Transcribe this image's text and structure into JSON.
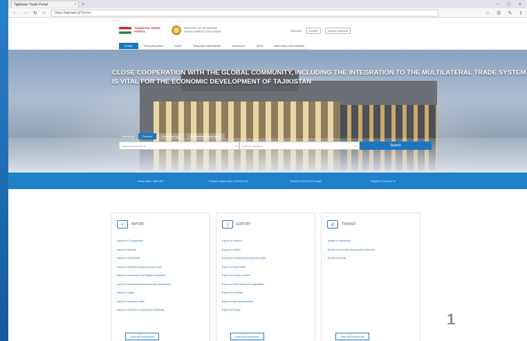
{
  "browser": {
    "tab_title": "Tajikistan Trade Portal",
    "tab_close": "×",
    "tab_new": "+",
    "url": "https://tajtrade.tj/?ru=en",
    "win_controls": [
      "−",
      "□",
      "×"
    ],
    "nav_icons": [
      "←",
      "→",
      "↻",
      "⌂"
    ],
    "right_icons": [
      "☆",
      "☰",
      "✎",
      "⇪"
    ]
  },
  "header": {
    "logo_text": "TAJIKISTAN TRADE PORTAL",
    "logo2_text": "MINISTRY OF ECONOMIC DEVELOPMENT AND TRADE",
    "lang_label": "Welcome",
    "lang_select": "English",
    "login_label": "Search products"
  },
  "nav": {
    "items": [
      "HOME",
      "PROCEDURES",
      "GATE",
      "TRADING PARTNERS",
      "PRODUCT",
      "WTO",
      "NATIONAL PROGRAMS"
    ]
  },
  "hero": {
    "title": "CLOSE COOPERATION WITH THE GLOBAL COMMUNITY, INCLUDING THE INTEGRATION TO THE MULTILATERAL TRADE SYSTEM IS VITAL FOR THE ECONOMIC DEVELOPMENT OF TAJIKISTAN",
    "search_label": "Search by",
    "search_tabs": [
      "Product",
      "Procedure type",
      "Regulation / requirement"
    ],
    "input1_placeholder": "Search by keyword",
    "input2_placeholder": "Select a product",
    "search_button": "Search"
  },
  "quicklinks": [
    "HOW CAN I IMPORT",
    "TRADE LAWS AND CONTACTS",
    "TRADE STATISTICS AND",
    "TRADE CONTACTS"
  ],
  "cards": [
    {
      "title": "IMPORT",
      "icon": "truck-import-icon",
      "items": [
        "Import of IT equipment",
        "Import of jewelry",
        "Import of chemicals",
        "Import of medical equipment and tools",
        "Import of cosmetics and hygiene products",
        "Import of pharmaceutical products (medicines)",
        "Import of sugar",
        "Import of tea and coffee",
        "Import of wood for construction materials"
      ],
      "view_all": "View all Procedures"
    },
    {
      "title": "EXPORT",
      "icon": "box-export-icon",
      "items": [
        "Export of cement",
        "Export of cotton",
        "Export of confectionery and chocolate",
        "Export of dried fruits",
        "Export of electric cables",
        "Export of fresh fruits and vegetables",
        "Export of furniture",
        "Export of garments/textiles",
        "Export of honey"
      ],
      "view_all": "View all Procedures"
    },
    {
      "title": "TRANSIT",
      "icon": "truck-transit-icon",
      "items": [
        "Transit of machinery",
        "Transit of wood for construction materials",
        "Transit of wheat"
      ],
      "view_all": "View all Procedures"
    }
  ],
  "slide_number": "1"
}
